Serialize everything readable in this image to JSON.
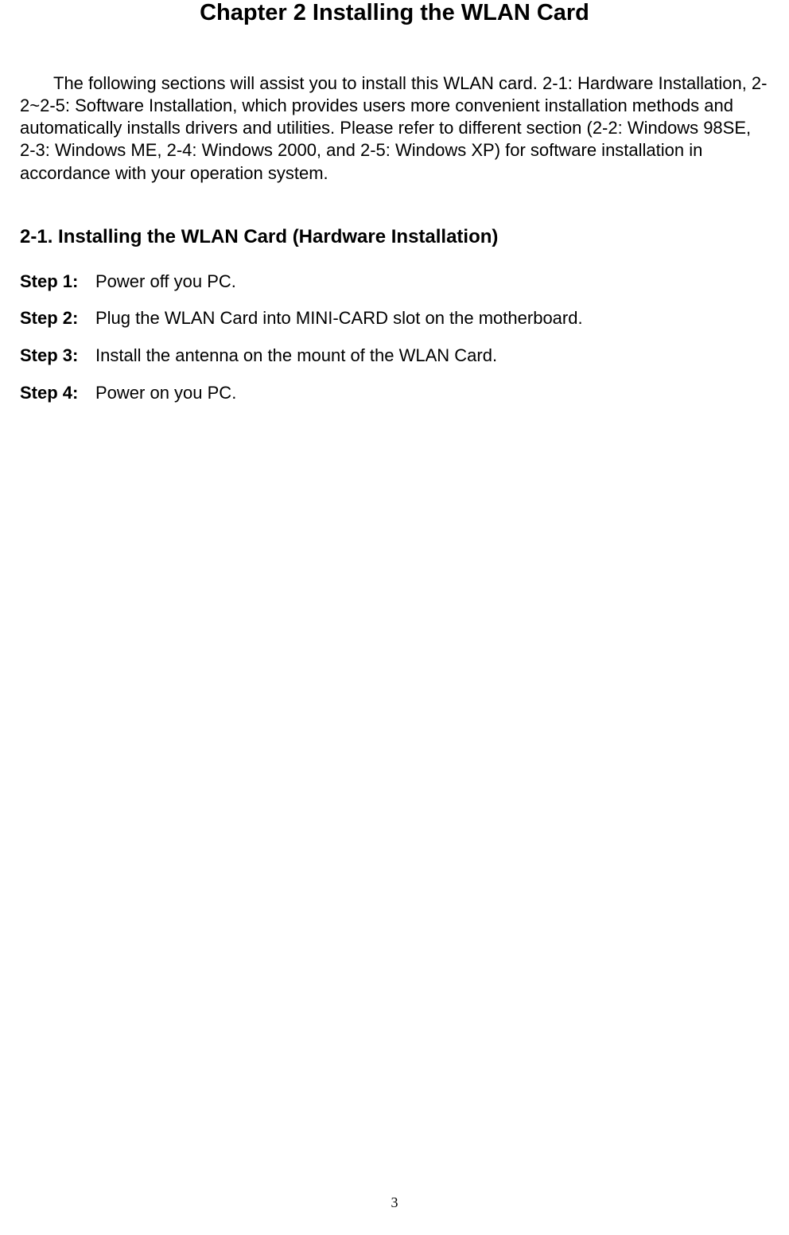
{
  "chapter": {
    "title": "Chapter 2    Installing the WLAN Card"
  },
  "intro": {
    "text": "The following sections will assist you to install this WLAN card. 2-1: Hardware Installation, 2-2~2-5: Software Installation, which provides users more convenient installation methods and automatically installs drivers and utilities. Please refer to different section (2-2: Windows 98SE, 2-3: Windows ME, 2-4: Windows 2000, and 2-5: Windows XP) for software installation in accordance with your operation system."
  },
  "section": {
    "title": "2-1.   Installing the WLAN Card (Hardware Installation)"
  },
  "steps": [
    {
      "label": "Step 1:",
      "text": "Power off you PC."
    },
    {
      "label": "Step 2:",
      "text": "Plug the WLAN Card into MINI-CARD slot on the motherboard."
    },
    {
      "label": "Step 3:",
      "text": "Install the antenna on the mount of the WLAN Card."
    },
    {
      "label": "Step 4:",
      "text": "Power on you PC."
    }
  ],
  "pageNumber": "3"
}
